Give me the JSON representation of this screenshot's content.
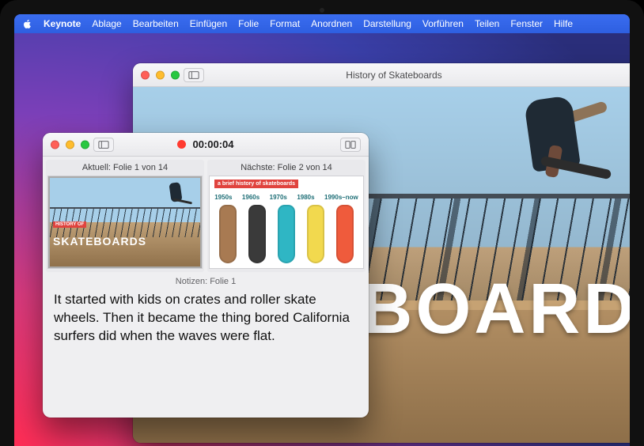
{
  "menubar": {
    "app": "Keynote",
    "items": [
      "Ablage",
      "Bearbeiten",
      "Einfügen",
      "Folie",
      "Format",
      "Anordnen",
      "Darstellung",
      "Vorführen",
      "Teilen",
      "Fenster",
      "Hilfe"
    ]
  },
  "slideshow_window": {
    "title": "History of Skateboards",
    "slide": {
      "history_badge": "HISTORY OF",
      "headline": "SKATEBOARDS"
    }
  },
  "presenter_window": {
    "timer": "00:00:04",
    "panes": {
      "current_label": "Aktuell: Folie 1 von 14",
      "next_label": "Nächste: Folie 2 von 14"
    },
    "next_slide": {
      "title": "a brief history of skateboards",
      "decades": [
        "1950s",
        "1960s",
        "1970s",
        "1980s",
        "1990s–now"
      ],
      "board_colors": [
        "#a87a52",
        "#3a3a3a",
        "#2fb6c4",
        "#f2d94e",
        "#ef5b3c"
      ]
    },
    "mini_current": {
      "history_badge": "HISTORY OF",
      "headline": "SKATEBOARDS"
    },
    "notes_label": "Notizen: Folie 1",
    "notes_body": "It started with kids on crates and roller skate wheels. Then it became the thing bored California surfers did when the waves were flat."
  }
}
